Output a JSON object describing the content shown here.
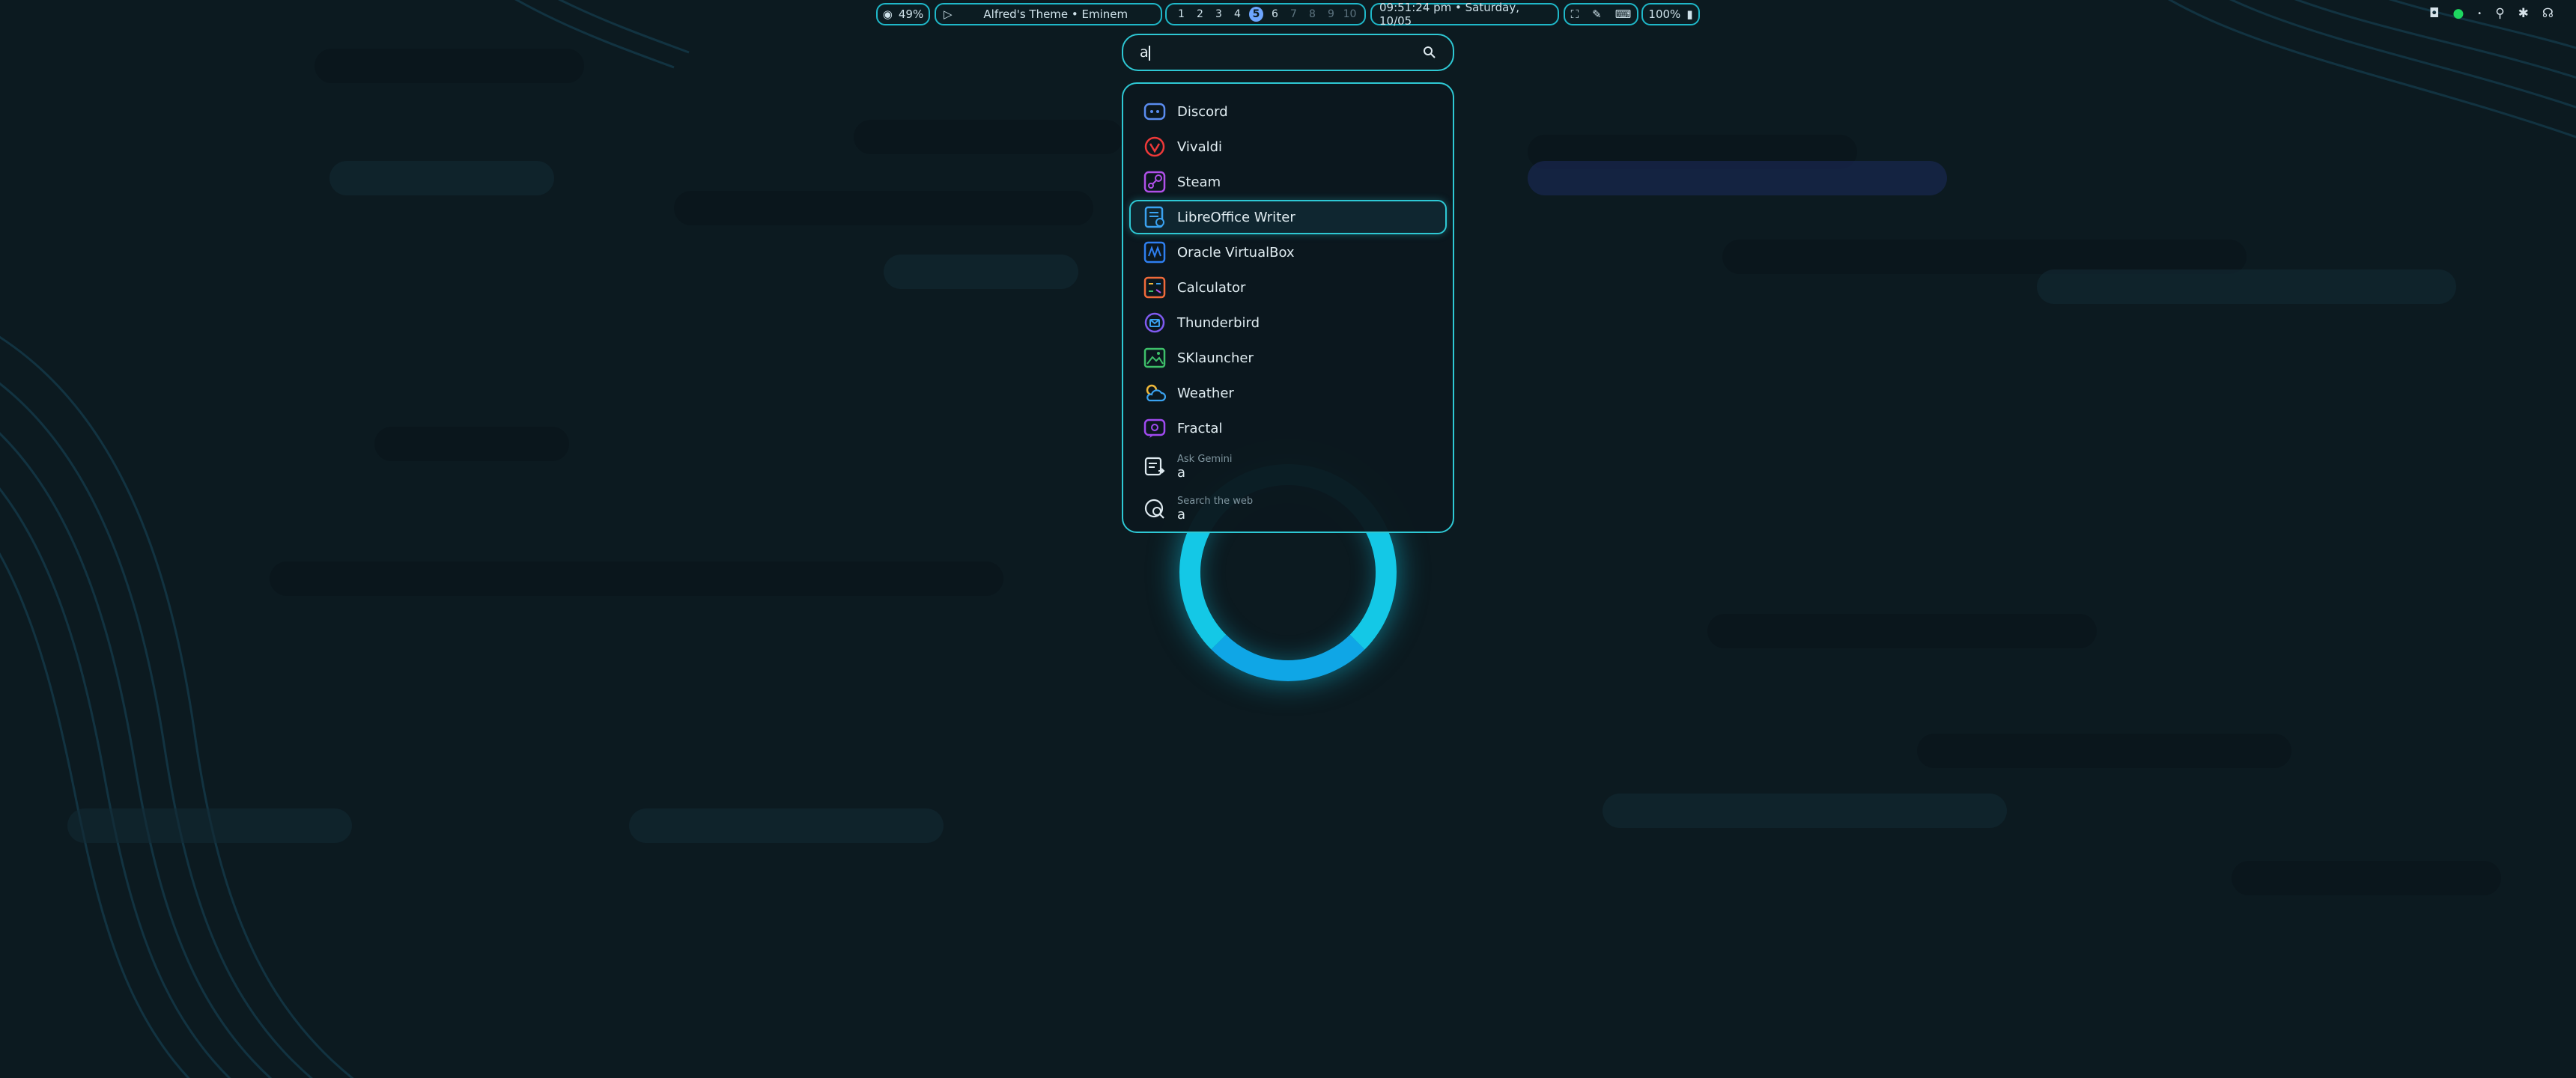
{
  "topbar": {
    "resource_value": "49%",
    "media_title": "Alfred's Theme • Eminem",
    "workspaces": [
      "1",
      "2",
      "3",
      "4",
      "5",
      "6",
      "7",
      "8",
      "9",
      "10"
    ],
    "active_workspace": "5",
    "clock": "09:51:24 pm • Saturday, 10/05",
    "brightness": "100%"
  },
  "launcher": {
    "query": "a",
    "apps": [
      {
        "label": "Discord",
        "icon": "discord-icon",
        "color": "#5a8cf0"
      },
      {
        "label": "Vivaldi",
        "icon": "vivaldi-icon",
        "color": "#ef3939"
      },
      {
        "label": "Steam",
        "icon": "steam-icon",
        "color": "#b050e8"
      },
      {
        "label": "LibreOffice Writer",
        "icon": "libreoffice-writer-icon",
        "color": "#3aa2f0",
        "selected": true
      },
      {
        "label": "Oracle VirtualBox",
        "icon": "virtualbox-icon",
        "color": "#2e7ff0"
      },
      {
        "label": "Calculator",
        "icon": "calculator-icon",
        "color": "#f06a3a"
      },
      {
        "label": "Thunderbird",
        "icon": "thunderbird-icon",
        "color": "#7f5af0"
      },
      {
        "label": "SKlauncher",
        "icon": "sklauncher-icon",
        "color": "#3ec06a"
      },
      {
        "label": "Weather",
        "icon": "weather-icon",
        "color": "#f0b83a"
      },
      {
        "label": "Fractal",
        "icon": "fractal-icon",
        "color": "#a04af0"
      }
    ],
    "actions": [
      {
        "title": "Ask Gemini",
        "value": "a",
        "icon": "ai-chat-icon"
      },
      {
        "title": "Search the web",
        "value": "a",
        "icon": "web-search-icon"
      }
    ]
  }
}
